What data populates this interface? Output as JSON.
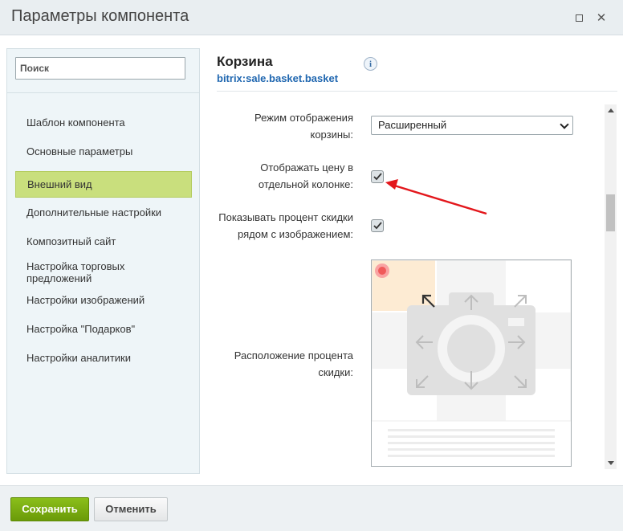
{
  "dialog": {
    "title": "Параметры компонента",
    "maximize_icon": "maximize-icon",
    "close_icon": "close-icon",
    "close_glyph": "✕"
  },
  "sidebar": {
    "search_placeholder": "Поиск",
    "items": [
      {
        "label": "Шаблон компонента",
        "active": false
      },
      {
        "label": "Основные параметры",
        "active": false
      },
      {
        "label": "Внешний вид",
        "active": true
      },
      {
        "label": "Дополнительные настройки",
        "active": false
      },
      {
        "label": "Композитный сайт",
        "active": false
      },
      {
        "label": "Настройка торговых предложений",
        "active": false
      },
      {
        "label": "Настройки изображений",
        "active": false
      },
      {
        "label": "Настройка \"Подарков\"",
        "active": false
      },
      {
        "label": "Настройки аналитики",
        "active": false
      }
    ]
  },
  "component": {
    "title": "Корзина",
    "code": "bitrix:sale.basket.basket",
    "info_glyph": "i"
  },
  "settings": {
    "display_mode_label": "Режим отображения корзины:",
    "display_mode_value": "Расширенный",
    "show_price_column_label": "Отображать цену в отдельной колонке:",
    "show_price_column_checked": true,
    "show_discount_percent_label": "Показывать процент скидки рядом с изображением:",
    "show_discount_percent_checked": true,
    "discount_position_label": "Расположение процента скидки:",
    "discount_position_selected": "top-left"
  },
  "footer": {
    "save_label": "Сохранить",
    "cancel_label": "Отменить"
  },
  "colors": {
    "active_item": "#c9df7d",
    "save_button": "#7aad12",
    "link": "#2067b0",
    "annotation_arrow": "#e3161b",
    "discount_dot": "#f05a5a"
  }
}
